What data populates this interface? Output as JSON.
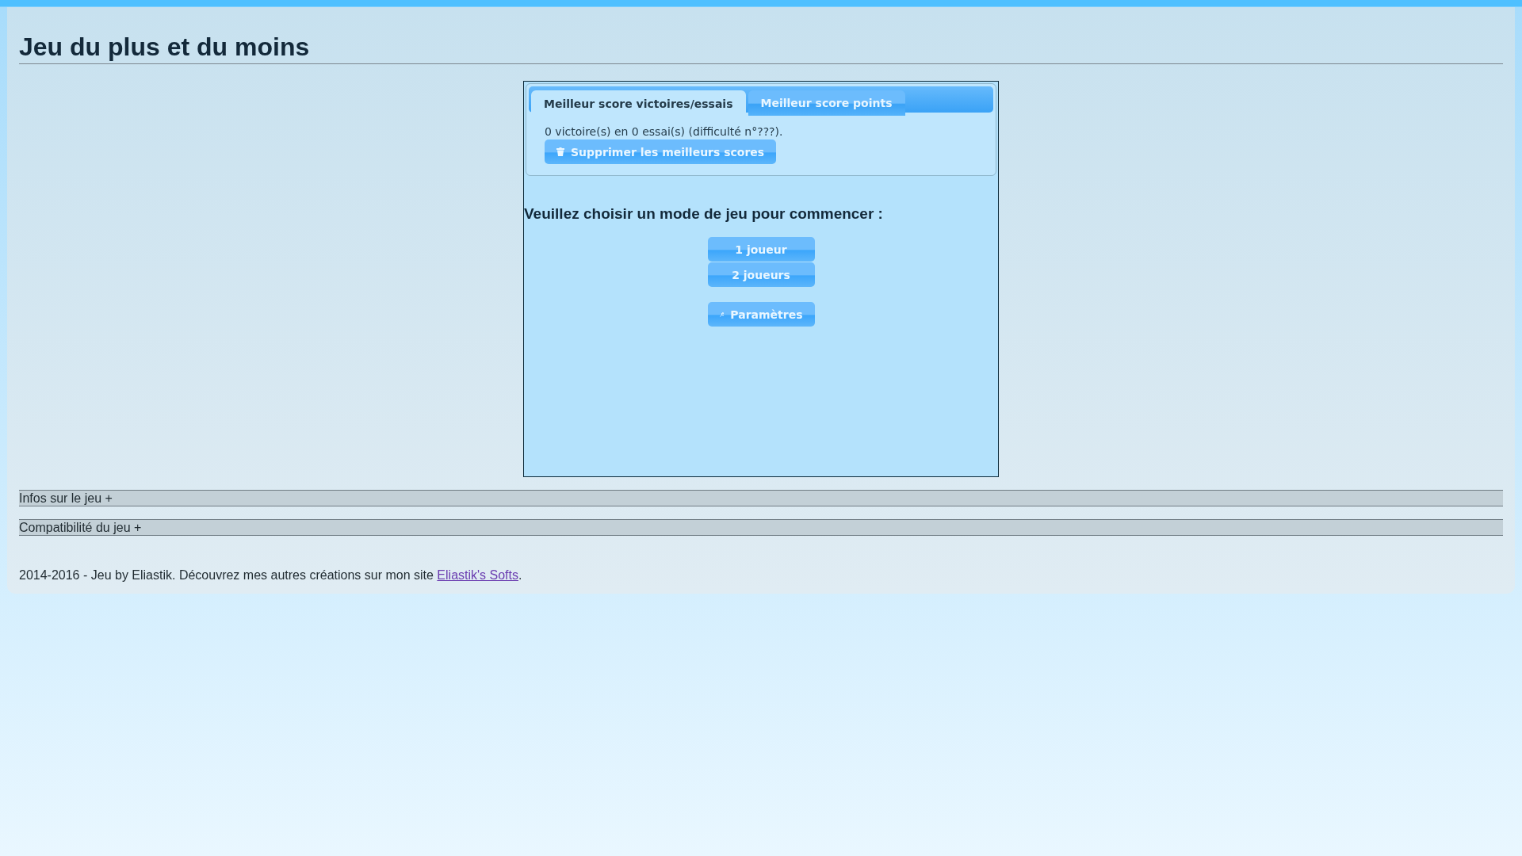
{
  "title": "Jeu du plus et du moins",
  "score_tabs": [
    {
      "label": "Meilleur score victoires/essais",
      "selected": true
    },
    {
      "label": "Meilleur score points",
      "selected": false
    }
  ],
  "score_text": "0 victoire(s) en 0 essai(s) (difficulté n°???).",
  "delete_button": "Supprimer les meilleurs scores",
  "prompt": "Veuillez choisir un mode de jeu pour commencer :",
  "mode_buttons": [
    "1 joueur",
    "2 joueurs"
  ],
  "settings_button": "Paramètres",
  "sections": [
    {
      "label": "Infos sur le jeu +"
    },
    {
      "label": "Compatibilité du jeu +"
    }
  ],
  "footer": {
    "text_before": "2014-2016 - Jeu by Eliastik. Découvrez mes autres créations sur mon site ",
    "link": "Eliastik's Softs",
    "text_after": "."
  }
}
